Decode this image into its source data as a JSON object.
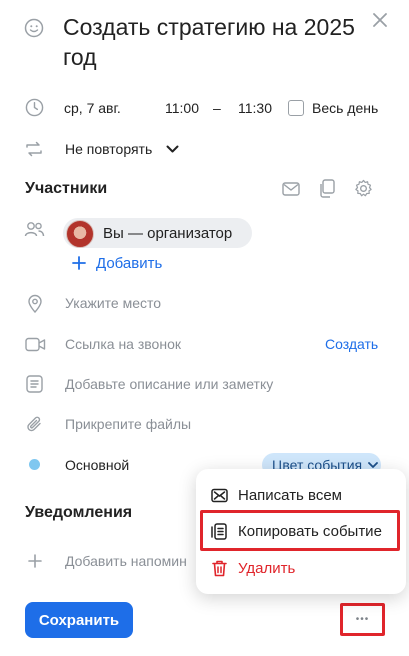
{
  "event": {
    "title": "Создать стратегию на 2025 год"
  },
  "datetime": {
    "date": "ср, 7 авг.",
    "start": "11:00",
    "dash": "–",
    "end": "11:30",
    "all_day_label": "Весь день",
    "all_day_checked": false
  },
  "repeat": {
    "label": "Не повторять"
  },
  "participants": {
    "section_title": "Участники",
    "organizer_label": "Вы — организатор",
    "add_label": "Добавить"
  },
  "location": {
    "placeholder": "Укажите место"
  },
  "call": {
    "placeholder": "Ссылка на звонок",
    "create_label": "Создать"
  },
  "description": {
    "placeholder": "Добавьте описание или заметку"
  },
  "attachments": {
    "placeholder": "Прикрепите файлы"
  },
  "calendar": {
    "name": "Основной",
    "color": "#7fc7f0",
    "color_button_label": "Цвет события"
  },
  "notifications": {
    "section_title": "Уведомления",
    "add_label": "Добавить напомин"
  },
  "footer": {
    "save_label": "Сохранить",
    "more_label": "•••"
  },
  "context_menu": {
    "items": [
      {
        "label": "Написать всем",
        "icon": "mail-all-icon"
      },
      {
        "label": "Копировать событие",
        "icon": "copy-event-icon"
      },
      {
        "label": "Удалить",
        "icon": "trash-icon"
      }
    ]
  },
  "colors": {
    "accent": "#1e6ee8",
    "danger": "#e0252b",
    "highlight_box": "#e0252b"
  }
}
